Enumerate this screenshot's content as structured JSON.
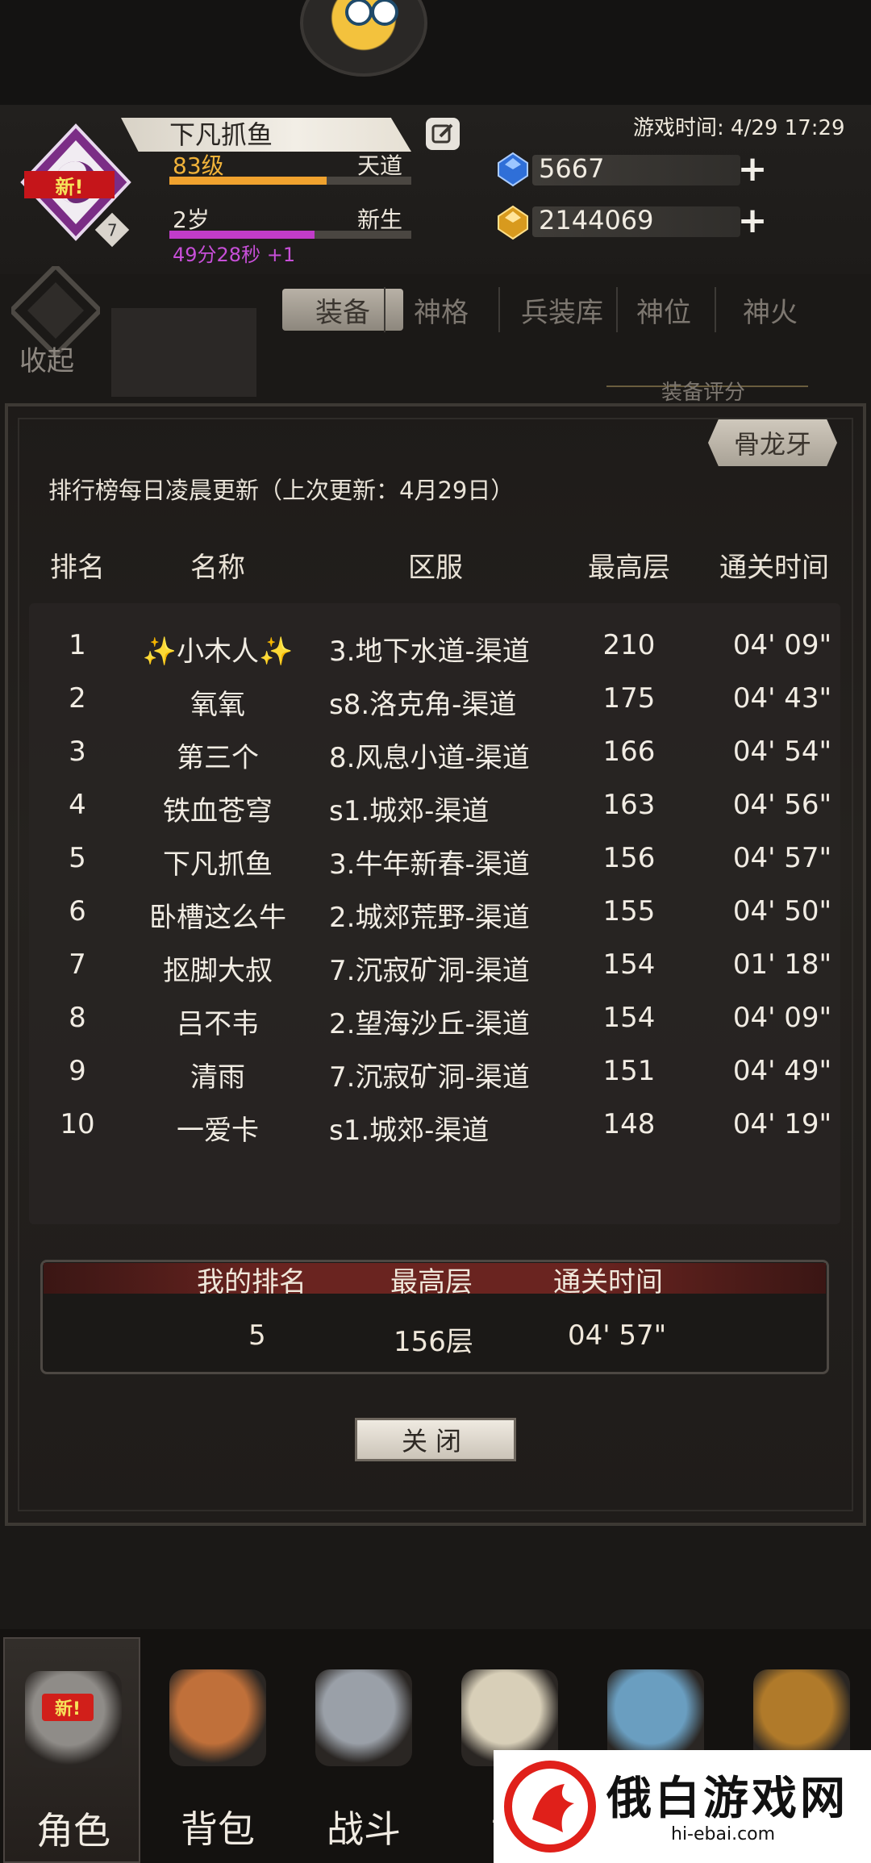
{
  "colors": {
    "accent_orange": "#f0a22e",
    "accent_purple": "#c13cc9",
    "level_text": "#f1b33a",
    "new_badge_red": "#d11f1a"
  },
  "header": {
    "player_name": "下凡抓鱼",
    "level": "83级",
    "realm": "天道",
    "level_progress": 0.65,
    "age": "2岁",
    "age_realm": "新生",
    "age_progress": 0.6,
    "age_timer": "49分28秒 +1",
    "avatar_badge_new": "新!",
    "avatar_badge_level": "7",
    "game_time": "游戏时间: 4/29 17:29",
    "gems": "5667",
    "gold": "2144069",
    "icons": {
      "edit": "edit-icon",
      "gem": "blue-gem-icon",
      "gold": "gold-gem-icon",
      "add": "plus-icon"
    }
  },
  "tabs": {
    "collapse_label": "收起",
    "items": [
      "装备",
      "神格",
      "兵装库",
      "神位",
      "神火"
    ],
    "active_index": 0,
    "gear_score_label": "装备评分"
  },
  "leaderboard": {
    "dungeon_button": "骨龙牙",
    "update_note": "排行榜每日凌晨更新（上次更新：4月29日）",
    "columns": [
      "排名",
      "名称",
      "区服",
      "最高层",
      "通关时间"
    ],
    "rows": [
      {
        "rank": "1",
        "name": "✨小木人✨",
        "server": "3.地下水道-渠道",
        "floor": "210",
        "time": "04' 09\""
      },
      {
        "rank": "2",
        "name": "氧氧",
        "server": "s8.洛克角-渠道",
        "floor": "175",
        "time": "04' 43\""
      },
      {
        "rank": "3",
        "name": "第三个",
        "server": "8.风息小道-渠道",
        "floor": "166",
        "time": "04' 54\""
      },
      {
        "rank": "4",
        "name": "铁血苍穹",
        "server": "s1.城郊-渠道",
        "floor": "163",
        "time": "04' 56\""
      },
      {
        "rank": "5",
        "name": "下凡抓鱼",
        "server": "3.牛年新春-渠道",
        "floor": "156",
        "time": "04' 57\""
      },
      {
        "rank": "6",
        "name": "卧槽这么牛",
        "server": "2.城郊荒野-渠道",
        "floor": "155",
        "time": "04' 50\""
      },
      {
        "rank": "7",
        "name": "抠脚大叔",
        "server": "7.沉寂矿洞-渠道",
        "floor": "154",
        "time": "01' 18\""
      },
      {
        "rank": "8",
        "name": "吕不韦",
        "server": "2.望海沙丘-渠道",
        "floor": "154",
        "time": "04' 09\""
      },
      {
        "rank": "9",
        "name": "清雨",
        "server": "7.沉寂矿洞-渠道",
        "floor": "151",
        "time": "04' 49\""
      },
      {
        "rank": "10",
        "name": "一爱卡",
        "server": "s1.城郊-渠道",
        "floor": "148",
        "time": "04' 19\""
      }
    ],
    "my_rank": {
      "headers": [
        "我的排名",
        "最高层",
        "通关时间"
      ],
      "rank": "5",
      "floor": "156层",
      "time": "04' 57\""
    },
    "close_button": "关闭"
  },
  "bottom_nav": {
    "items": [
      {
        "label": "角色",
        "icon": "helmet-icon"
      },
      {
        "label": "背包",
        "icon": "backpack-icon"
      },
      {
        "label": "战斗",
        "icon": "sword-shield-icon"
      },
      {
        "label": "世",
        "icon": "scroll-icon"
      },
      {
        "label": "",
        "icon": "castle-icon"
      },
      {
        "label": "",
        "icon": "puzzle-box-icon"
      }
    ],
    "active_index": 0,
    "new_badge": "新!"
  },
  "watermark": {
    "brand_name": "俄白游戏网",
    "brand_url": "hi-ebai.com"
  }
}
